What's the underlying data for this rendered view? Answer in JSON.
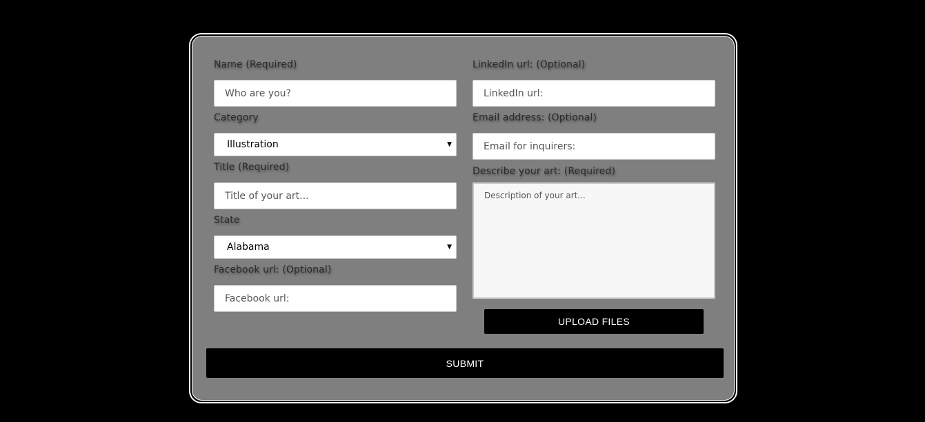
{
  "form": {
    "left": {
      "name": {
        "label": "Name (Required)",
        "placeholder": "Who are you?"
      },
      "category": {
        "label": "Category",
        "selected": "Illustration"
      },
      "title": {
        "label": "Title (Required)",
        "placeholder": "Title of your art..."
      },
      "state": {
        "label": "State",
        "selected": "Alabama"
      },
      "facebook": {
        "label": "Facebook url: (Optional)",
        "placeholder": "Facebook url:"
      }
    },
    "right": {
      "linkedin": {
        "label": "LinkedIn url: (Optional)",
        "placeholder": "LinkedIn url:"
      },
      "email": {
        "label": "Email address: (Optional)",
        "placeholder": "Email for inquirers:"
      },
      "description": {
        "label": "Describe your art: (Required)",
        "placeholder": "Description of your art..."
      }
    },
    "upload_label": "UPLOAD FILES",
    "submit_label": "SUBMIT",
    "caret_glyph": "▼"
  },
  "colors": {
    "page_background": "#000000",
    "card_background": "#7f7f7f",
    "card_border": "#ffffff",
    "button_background": "#000000",
    "button_text": "#ffffff"
  }
}
